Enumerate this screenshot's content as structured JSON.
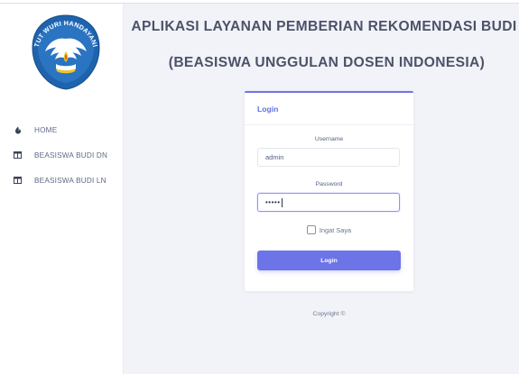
{
  "sidebar": {
    "logo_text": "TUT WURI HANDAYANI",
    "items": [
      {
        "label": "HOME",
        "icon": "home-icon"
      },
      {
        "label": "BEASISWA BUDI DN",
        "icon": "table-icon"
      },
      {
        "label": "BEASISWA BUDI LN",
        "icon": "table-icon"
      }
    ]
  },
  "header": {
    "title_line1": "APLIKASI LAYANAN PEMBERIAN REKOMENDASI BUDI",
    "title_line2": "(BEASISWA UNGGULAN DOSEN INDONESIA)"
  },
  "login": {
    "heading": "Login",
    "username_label": "Username",
    "username_value": "admin",
    "password_label": "Password",
    "password_value": "•••••",
    "remember_label": "Ingat Saya",
    "remember_checked": false,
    "button_label": "Login"
  },
  "footer": {
    "copyright": "Copyright ©"
  },
  "colors": {
    "accent": "#6c74e8",
    "logo_blue": "#1f5fa8",
    "background": "#f2f3f8"
  }
}
